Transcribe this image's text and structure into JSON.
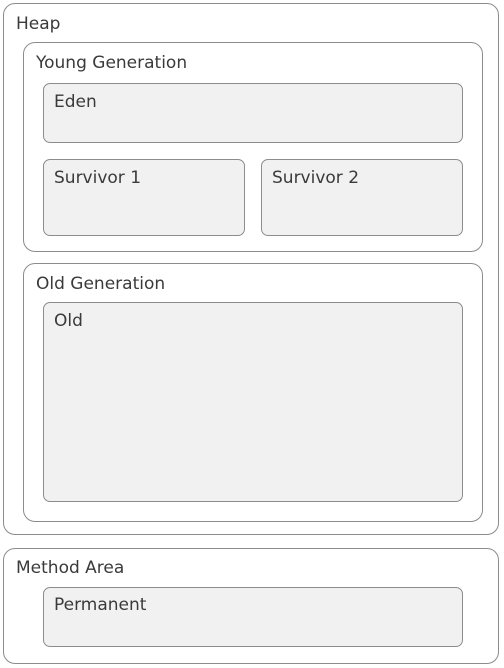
{
  "heap": {
    "label": "Heap",
    "young_generation": {
      "label": "Young Generation",
      "eden": "Eden",
      "survivor_1": "Survivor 1",
      "survivor_2": "Survivor 2"
    },
    "old_generation": {
      "label": "Old Generation",
      "old": "Old"
    }
  },
  "method_area": {
    "label": "Method Area",
    "permanent": "Permanent"
  }
}
